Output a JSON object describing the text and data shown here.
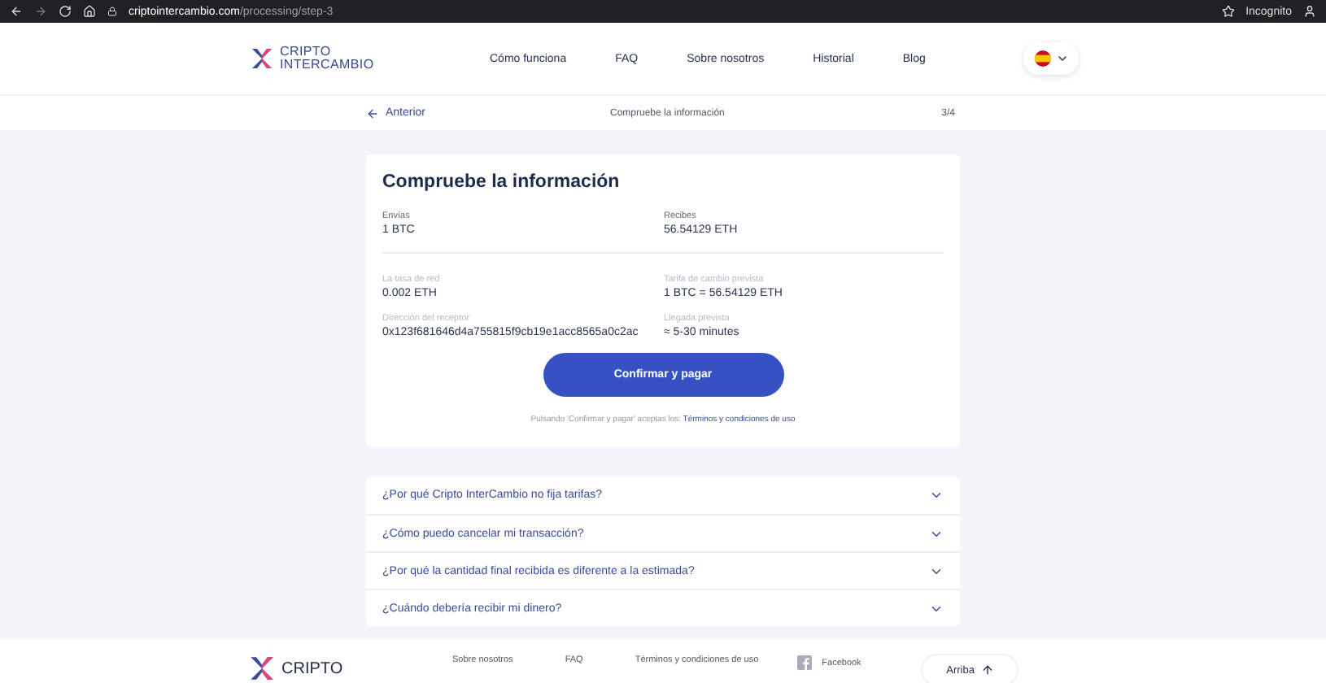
{
  "browser": {
    "url_host": "criptointercambio.com",
    "url_path": "/processing/step-3",
    "profile": "Incognito"
  },
  "header": {
    "logo": [
      "CRIPTO",
      "INTERCAMBIO"
    ],
    "nav": [
      "Cómo funciona",
      "FAQ",
      "Sobre nosotros",
      "Historial",
      "Blog"
    ]
  },
  "subbar": {
    "back": "Anterior",
    "title": "Compruebe la información",
    "step": "3/4"
  },
  "card": {
    "title": "Compruebe la información",
    "rows": [
      [
        {
          "label": "Envías",
          "value": "1 BTC"
        },
        {
          "label": "Recibes",
          "value": "56.54129 ETH"
        }
      ],
      [
        {
          "label": "La tasa de red",
          "value": "0.002 ETH"
        },
        {
          "label": "Tarifa de cambio prevista",
          "value": "1 BTC = 56.54129 ETH"
        }
      ],
      [
        {
          "label": "Dirección del receptor",
          "value": "0x123f681646d4a755815f9cb19e1acc8565a0c2ac"
        },
        {
          "label": "Llegada prevista",
          "value": "≈ 5-30 minutes"
        }
      ]
    ],
    "button": "Confirmar y pagar",
    "terms": "Pulsando 'Confirmar y pagar' aceptas los:",
    "terms_link": "Términos y condiciones de uso"
  },
  "faq": [
    {
      "question": "¿Por qué Cripto InterCambio no fija tarifas?",
      "expanded": false
    },
    {
      "question": "¿Cómo puedo cancelar mi transacción?",
      "expanded": false
    },
    {
      "question": "¿Por qué la cantidad final recibida es diferente a la estimada?",
      "expanded": false
    },
    {
      "question": "¿Cuándo debería recibir mi dinero?",
      "expanded": false
    }
  ],
  "footer": {
    "logo": "CRIPTO",
    "links": [
      "Sobre nosotros",
      "FAQ",
      "Términos y condiciones de uso"
    ],
    "social": "Facebook",
    "top": "Arriba"
  }
}
